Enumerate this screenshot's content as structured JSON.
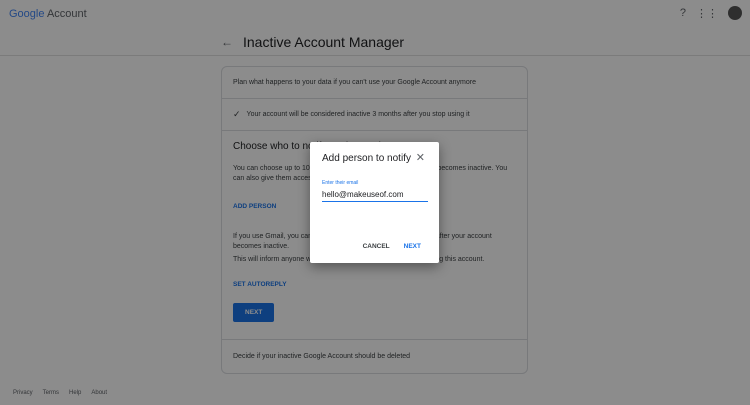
{
  "header": {
    "logo_google": "Google",
    "logo_account": "Account",
    "help_icon": "?",
    "apps_icon": "⋮⋮"
  },
  "page": {
    "title": "Inactive Account Manager",
    "back": "←"
  },
  "card": {
    "intro": "Plan what happens to your data if you can't use your Google Account anymore",
    "inactive_notice": "Your account will be considered inactive 3 months after you stop using it",
    "section_title": "Choose who to notify & what to share",
    "section_text1": "You can choose up to 10 people to be notified when your account becomes inactive. You can also give them access to some of your data.",
    "add_person": "ADD PERSON",
    "gmail_text": "If you use Gmail, you can also send an automatic reply to people after your account becomes inactive.",
    "inform_text": "This will inform anyone who emails you that you are no longer using this account.",
    "set_autoreply": "SET AUTOREPLY",
    "next": "NEXT",
    "delete_text": "Decide if your inactive Google Account should be deleted"
  },
  "footer": [
    "Privacy",
    "Terms",
    "Help",
    "About"
  ],
  "dialog": {
    "title": "Add person to notify",
    "email_label": "Enter their email",
    "email_value": "hello@makeuseof.com",
    "cancel": "CANCEL",
    "next": "NEXT"
  }
}
